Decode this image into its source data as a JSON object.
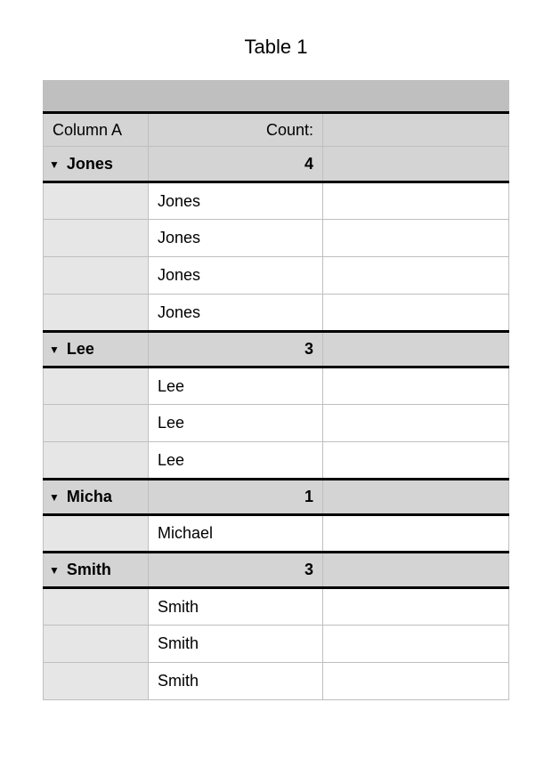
{
  "title": "Table 1",
  "headers": {
    "columnA": "Column A",
    "countLabel": "Count:"
  },
  "triangle": "▼",
  "groups": [
    {
      "name": "Jones",
      "count": 4,
      "rows": [
        "Jones",
        "Jones",
        "Jones",
        "Jones"
      ]
    },
    {
      "name": "Lee",
      "count": 3,
      "rows": [
        "Lee",
        "Lee",
        "Lee"
      ]
    },
    {
      "name": "Micha",
      "count": 1,
      "rows": [
        "Michael"
      ]
    },
    {
      "name": "Smith",
      "count": 3,
      "rows": [
        "Smith",
        "Smith",
        "Smith"
      ]
    }
  ]
}
